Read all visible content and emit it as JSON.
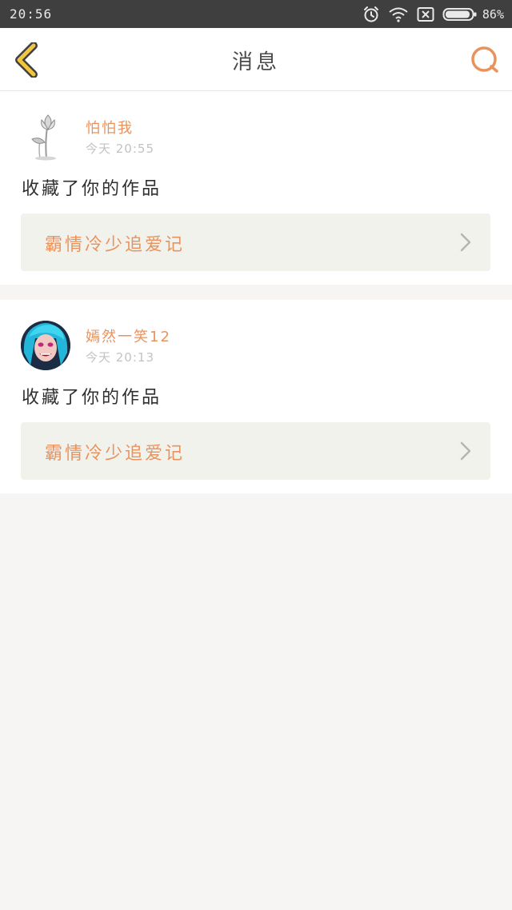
{
  "status_bar": {
    "time": "20:56",
    "battery_percent": "86%"
  },
  "header": {
    "title": "消息",
    "icons": {
      "back": "back-chevron-icon",
      "search": "search-icon"
    }
  },
  "colors": {
    "accent": "#e8935e",
    "back_icon": "#f0c640",
    "card_link_bg": "#f2f2ed",
    "page_bg": "#f6f5f4"
  },
  "notifications": [
    {
      "username": "怕怕我",
      "time": "今天 20:55",
      "message": "收藏了你的作品",
      "work_title": "霸情冷少追爱记"
    },
    {
      "username": "嫣然一笑12",
      "time": "今天 20:13",
      "message": "收藏了你的作品",
      "work_title": "霸情冷少追爱记"
    }
  ]
}
